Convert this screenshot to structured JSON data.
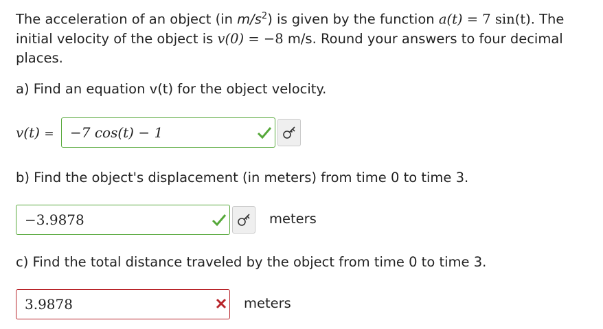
{
  "intro": {
    "p1": "The acceleration of an object (in ",
    "unit_base": "m/s",
    "unit_exp": "2",
    "p2": ") is given by the function ",
    "a_expr_lhs": "a(t)",
    "a_expr_eq": " = ",
    "a_expr_rhs": "7 sin(t)",
    "p3": ". The initial velocity of the object is ",
    "v0_lhs": "v(0)",
    "v0_eq": " = ",
    "v0_rhs": "−8",
    "p4": " m/s. Round your answers to four decimal places."
  },
  "part_a": {
    "question": "a) Find an equation v(t) for the object velocity.",
    "label": "v(t)",
    "eq_sign": "=",
    "answer": "−7 cos(t) − 1",
    "status": "correct"
  },
  "part_b": {
    "question": "b) Find the object's displacement (in meters) from time 0 to time 3.",
    "answer": "−3.9878",
    "status": "correct",
    "units": "meters"
  },
  "part_c": {
    "question": "c) Find the total distance traveled by the object from time 0 to time 3.",
    "answer": "3.9878",
    "status": "incorrect",
    "units": "meters"
  },
  "icons": {
    "correct": "checkmark-icon",
    "incorrect": "x-mark-icon",
    "key": "key-icon"
  },
  "colors": {
    "correct": "#56a83a",
    "incorrect": "#b8242a"
  }
}
